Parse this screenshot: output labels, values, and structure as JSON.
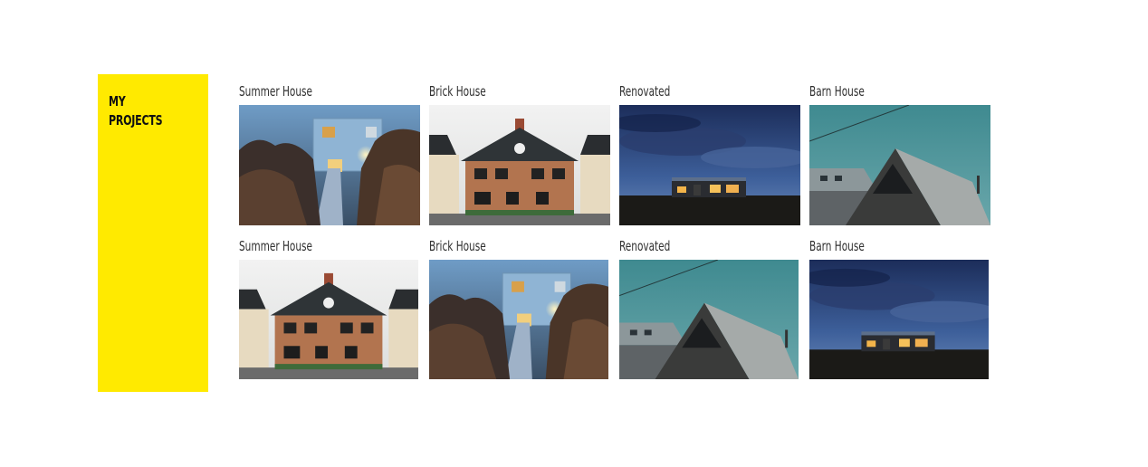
{
  "sidebar": {
    "title_line1": "MY",
    "title_line2": "PROJECTS",
    "color": "#ffea00"
  },
  "projects": [
    {
      "label": "Summer House",
      "scene": "summer-house"
    },
    {
      "label": "Brick House",
      "scene": "brick-house"
    },
    {
      "label": "Renovated",
      "scene": "night-house"
    },
    {
      "label": "Barn House",
      "scene": "barn-house"
    },
    {
      "label": "Summer House",
      "scene": "brick-house"
    },
    {
      "label": "Brick House",
      "scene": "summer-house"
    },
    {
      "label": "Renovated",
      "scene": "barn-house"
    },
    {
      "label": "Barn House",
      "scene": "night-house"
    }
  ]
}
